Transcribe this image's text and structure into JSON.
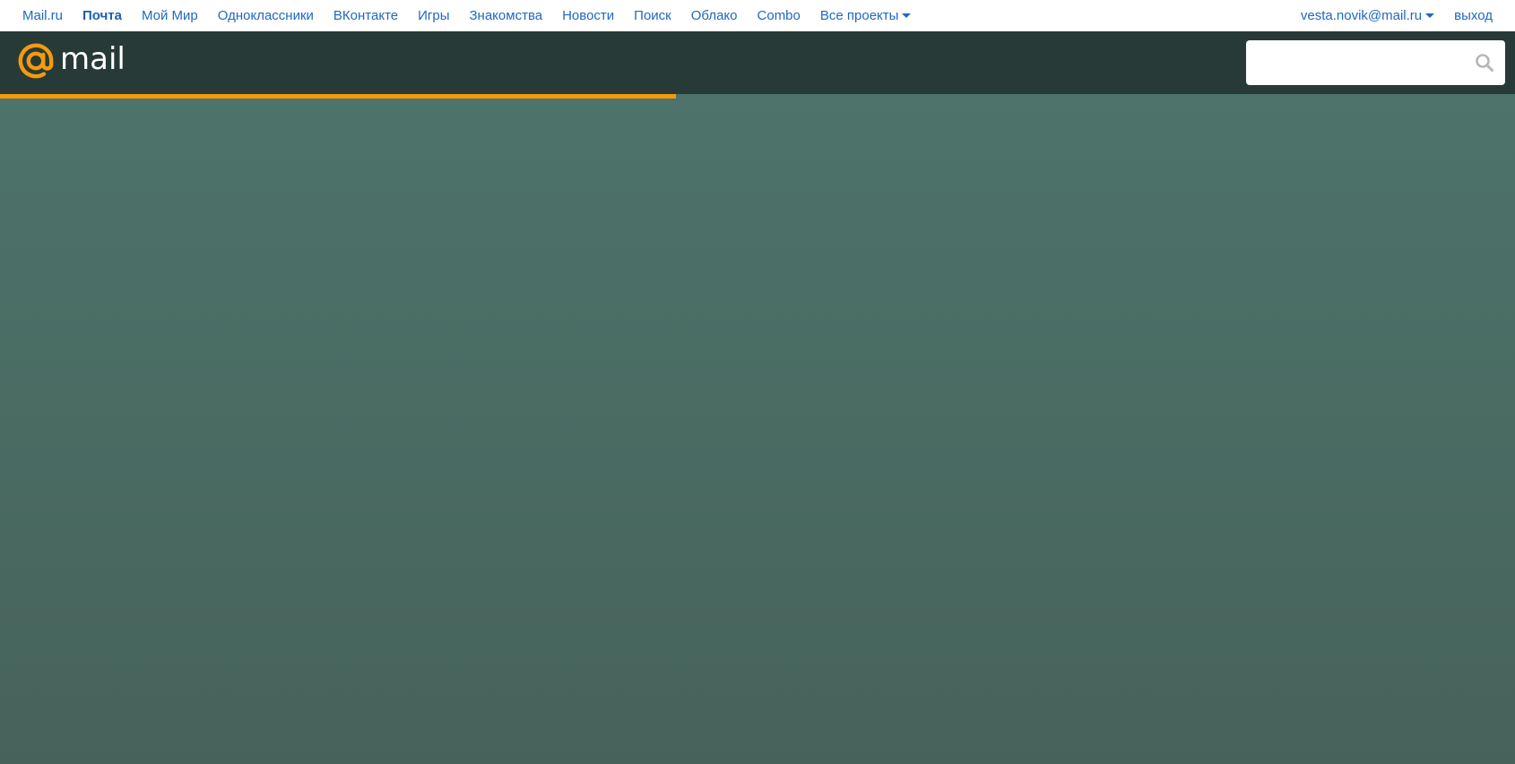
{
  "portal_nav": {
    "items": [
      {
        "label": "Mail.ru",
        "active": false
      },
      {
        "label": "Почта",
        "active": true
      },
      {
        "label": "Мой Мир",
        "active": false
      },
      {
        "label": "Одноклассники",
        "active": false
      },
      {
        "label": "ВКонтакте",
        "active": false
      },
      {
        "label": "Игры",
        "active": false
      },
      {
        "label": "Знакомства",
        "active": false
      },
      {
        "label": "Новости",
        "active": false
      },
      {
        "label": "Поиск",
        "active": false
      },
      {
        "label": "Облако",
        "active": false
      },
      {
        "label": "Combo",
        "active": false
      }
    ],
    "all_projects_label": "Все проекты",
    "user_email": "vesta.novik@mail.ru",
    "logout_label": "выход"
  },
  "header": {
    "logo_text": "mail",
    "logo_icon": "at-sign-icon",
    "search": {
      "value": "",
      "placeholder": "",
      "icon": "search-icon"
    }
  },
  "loading": {
    "progress": 0.446
  },
  "colors": {
    "link": "#2069c0",
    "header_bg": "#283a37",
    "accent": "#f49b0b",
    "content_bg": "#4b6d64"
  }
}
